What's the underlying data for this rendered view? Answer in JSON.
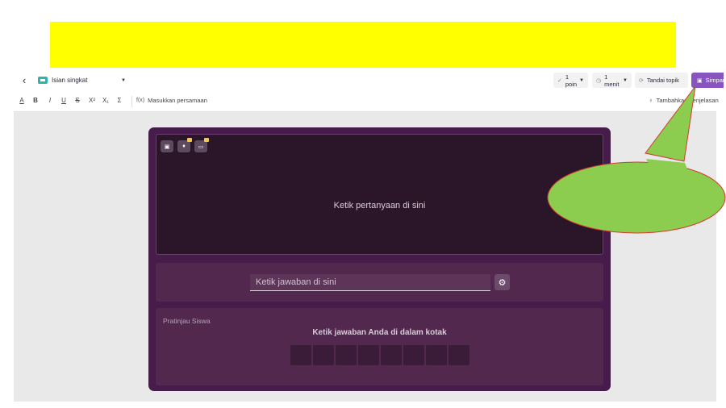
{
  "header": {
    "question_type": "Isian singkat",
    "points": "1 poin",
    "time": "1 menit",
    "tag_topic": "Tandai topik",
    "save": "Simpan"
  },
  "toolbar": {
    "format": [
      "A",
      "B",
      "I",
      "U",
      "S",
      "X²",
      "X₁",
      "Σ"
    ],
    "equation": "Masukkan persamaan",
    "explanation": "Tambahkan penjelasan"
  },
  "question": {
    "placeholder": "Ketik pertanyaan di sini"
  },
  "answer": {
    "placeholder": "Ketik jawaban di sini"
  },
  "preview": {
    "label": "Pratinjau Siswa",
    "instruction": "Ketik jawaban Anda di dalam kotak",
    "slot_count": 8
  },
  "colors": {
    "banner": "#ffff00",
    "accent": "#8854c0",
    "card": "#461c4b",
    "callout": "#8ccc4e"
  },
  "icons": [
    "back-icon",
    "image-icon",
    "mic-icon",
    "video-icon",
    "gear-icon",
    "check-icon",
    "clock-icon",
    "tag-icon",
    "save-icon",
    "lightbulb-icon"
  ]
}
